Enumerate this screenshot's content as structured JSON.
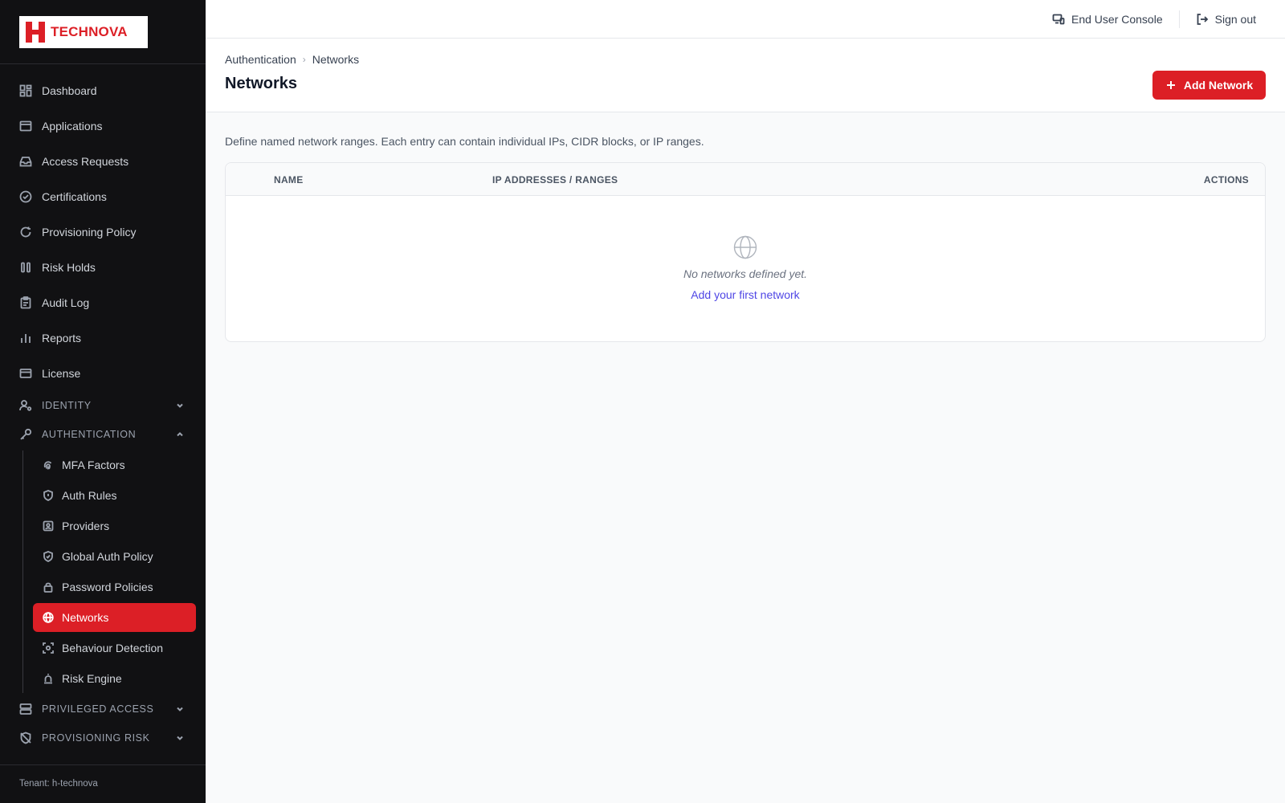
{
  "brand": {
    "name": "TECHNOVA",
    "accent": "#dc1f26"
  },
  "sidebar": {
    "items": [
      {
        "label": "Dashboard",
        "icon": "dashboard-icon"
      },
      {
        "label": "Applications",
        "icon": "window-icon"
      },
      {
        "label": "Access Requests",
        "icon": "inbox-icon"
      },
      {
        "label": "Certifications",
        "icon": "check-circle-icon"
      },
      {
        "label": "Provisioning Policy",
        "icon": "refresh-icon"
      },
      {
        "label": "Risk Holds",
        "icon": "pause-icon"
      },
      {
        "label": "Audit Log",
        "icon": "clipboard-icon"
      },
      {
        "label": "Reports",
        "icon": "bar-chart-icon"
      },
      {
        "label": "License",
        "icon": "card-icon"
      }
    ],
    "sections": {
      "identity": "IDENTITY",
      "authentication": "AUTHENTICATION",
      "privileged_access": "PRIVILEGED ACCESS",
      "provisioning_risk": "PROVISIONING RISK"
    },
    "auth_items": [
      {
        "label": "MFA Factors",
        "icon": "fingerprint-icon"
      },
      {
        "label": "Auth Rules",
        "icon": "shield-icon"
      },
      {
        "label": "Providers",
        "icon": "id-card-icon"
      },
      {
        "label": "Global Auth Policy",
        "icon": "shield-check-icon"
      },
      {
        "label": "Password Policies",
        "icon": "lock-icon"
      },
      {
        "label": "Networks",
        "icon": "globe-icon",
        "active": true
      },
      {
        "label": "Behaviour Detection",
        "icon": "eye-scan-icon"
      },
      {
        "label": "Risk Engine",
        "icon": "siren-icon"
      }
    ],
    "tenant": "Tenant: h-technova"
  },
  "topbar": {
    "console": "End User Console",
    "signout": "Sign out"
  },
  "header": {
    "breadcrumb": [
      "Authentication",
      "Networks"
    ],
    "title": "Networks",
    "add_button": "Add Network"
  },
  "main": {
    "description": "Define named network ranges. Each entry can contain individual IPs, CIDR blocks, or IP ranges.",
    "columns": [
      "NAME",
      "IP ADDRESSES / RANGES",
      "ACTIONS"
    ],
    "empty_message": "No networks defined yet.",
    "empty_link": "Add your first network"
  }
}
